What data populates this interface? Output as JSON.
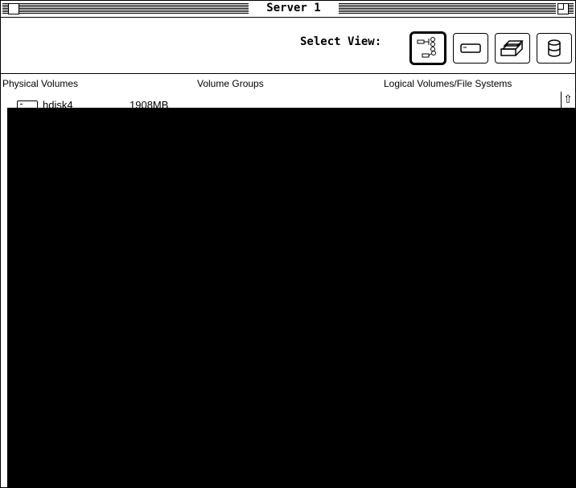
{
  "window": {
    "title": "Server 1"
  },
  "toolbar": {
    "select_view_label": "Select View:",
    "views": [
      {
        "icon": "volume-map-icon",
        "selected": true
      },
      {
        "icon": "physical-disk-icon",
        "selected": false
      },
      {
        "icon": "stacked-volumes-icon",
        "selected": false
      },
      {
        "icon": "cylinder-storage-icon",
        "selected": false
      }
    ]
  },
  "columns": {
    "physical": "Physical Volumes",
    "groups": "Volume Groups",
    "logical": "Logical Volumes/File Systems"
  },
  "rows": [
    {
      "name": "hdisk4",
      "size": "1908MB"
    }
  ]
}
